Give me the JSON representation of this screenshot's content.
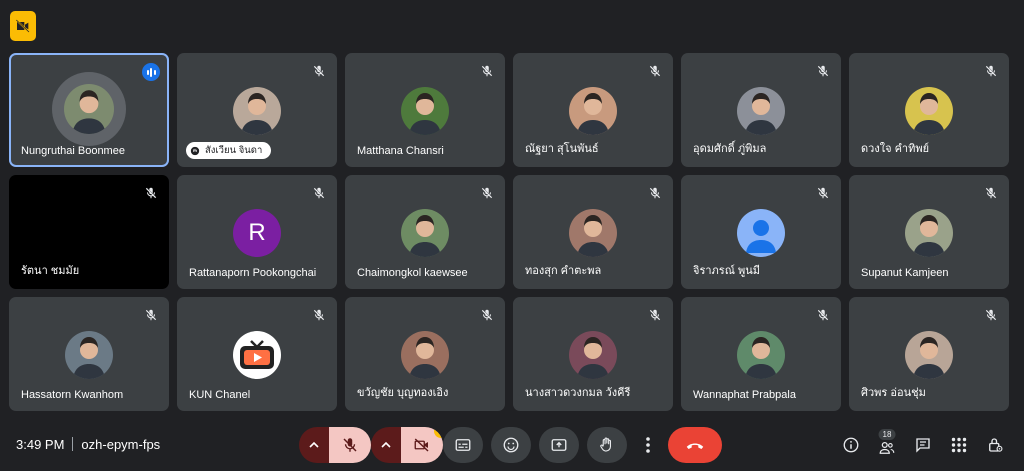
{
  "meeting": {
    "time": "3:49 PM",
    "code": "ozh-epym-fps",
    "participant_count": "18"
  },
  "participants": [
    {
      "name": "Nungruthai Boonmee",
      "speaking": true,
      "bg": "#7d8b6f"
    },
    {
      "name": "สังเวียน จินดา",
      "pinned_chip": true,
      "bg": "#b9a89a"
    },
    {
      "name": "Matthana Chansri",
      "bg": "#4e7a3c"
    },
    {
      "name": "ณัฐยา สุโนพันธ์",
      "bg": "#c89a7e"
    },
    {
      "name": "อุดมศักดิ์ ภู่พิมล",
      "bg": "#8c9099"
    },
    {
      "name": "ดวงใจ คำทิพย์",
      "bg": "#d7c34e"
    },
    {
      "name": "รัตนา ชมมัย",
      "video_off_black": true
    },
    {
      "name": "Rattanaporn Pookongchai",
      "letter": "R",
      "bg": "#7b1fa2"
    },
    {
      "name": "Chaimongkol kaewsee",
      "bg": "#6e8c63"
    },
    {
      "name": "ทองสุก คำตะพล",
      "bg": "#a0786a"
    },
    {
      "name": "จิราภรณ์ พูนมี",
      "default_avatar": true,
      "bg": "#8ab4f8"
    },
    {
      "name": "Supanut Kamjeen",
      "bg": "#9aa28a"
    },
    {
      "name": "Hassatorn Kwanhom",
      "bg": "#6b7a86"
    },
    {
      "name": "KUN Chanel",
      "tv_logo": true,
      "bg": "#ffffff"
    },
    {
      "name": "ขวัญชัย บุญทองเอิง",
      "bg": "#9a6f5f"
    },
    {
      "name": "นางสาวดวงกมล วังคีรี",
      "bg": "#7a4a5a"
    },
    {
      "name": "Wannaphat Prabpala",
      "bg": "#5f8a6a"
    },
    {
      "name": "ศิวพร อ่อนชุ่ม",
      "bg": "#b8a597"
    }
  ],
  "colors": {
    "speaking": "#1a73e8",
    "active_border": "#8ab4f8",
    "leave": "#ea4335",
    "warning": "#fbbc04"
  },
  "icons": {
    "top_badge": "camera-off-badge-icon",
    "mic": "mic-off-icon",
    "camera": "camera-off-icon",
    "captions": "captions-icon",
    "emoji": "emoji-icon",
    "present": "present-icon",
    "hand": "raise-hand-icon",
    "more": "more-vert-icon",
    "leave": "call-end-icon",
    "info": "info-icon",
    "people": "people-icon",
    "chat": "chat-icon",
    "activities": "apps-icon",
    "host": "host-controls-icon"
  }
}
